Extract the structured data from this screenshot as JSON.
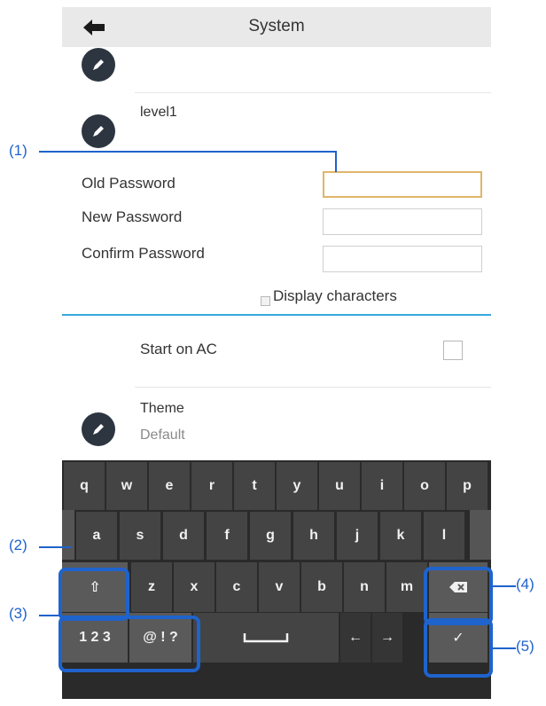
{
  "header": {
    "title": "System",
    "back_icon": "back-arrow-icon"
  },
  "items": {
    "level1_label": "level1",
    "old_password_label": "Old Password",
    "new_password_label": "New Password",
    "confirm_password_label": "Confirm Password",
    "display_characters_label": "Display characters",
    "start_on_ac_label": "Start on AC",
    "theme_label": "Theme",
    "theme_value": "Default"
  },
  "keyboard": {
    "row1": [
      "q",
      "w",
      "e",
      "r",
      "t",
      "y",
      "u",
      "i",
      "o",
      "p"
    ],
    "row2": [
      "a",
      "s",
      "d",
      "f",
      "g",
      "h",
      "j",
      "k",
      "l"
    ],
    "row3": [
      "z",
      "x",
      "c",
      "v",
      "b",
      "n",
      "m"
    ],
    "shift": "⇧",
    "numbers": "1 2 3",
    "symbols": "@ ! ?",
    "left": "←",
    "right": "→",
    "confirm": "✓"
  },
  "callouts": {
    "c1": "(1)",
    "c2": "(2)",
    "c3": "(3)",
    "c4": "(4)",
    "c5": "(5)"
  },
  "colors": {
    "accent": "#1f63cc",
    "focus": "#e0b56a",
    "divider_blue": "#36a8e0",
    "keyboard_bg": "#2a2a2a"
  }
}
